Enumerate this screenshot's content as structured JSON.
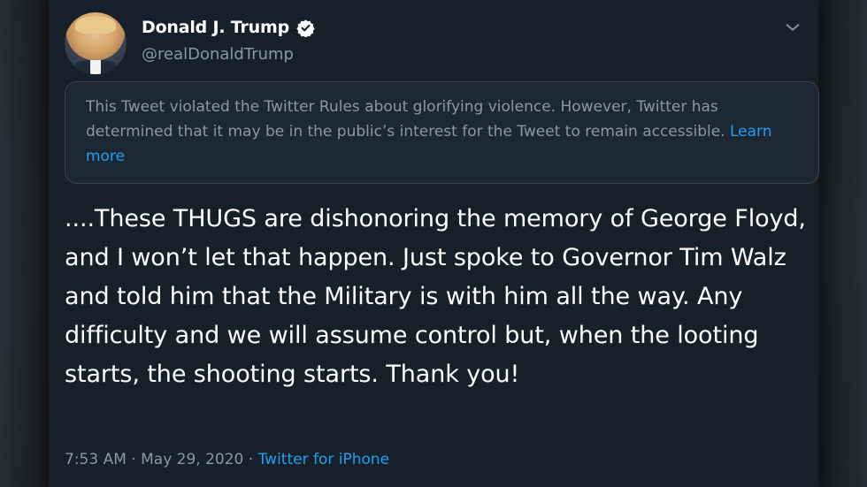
{
  "author": {
    "display_name": "Donald J. Trump",
    "handle": "@realDonaldTrump",
    "verified_icon": "verified-badge-icon"
  },
  "notice": {
    "text": "This Tweet violated the Twitter Rules about glorifying violence. However, Twitter has determined that it may be in the public’s interest for the Tweet to remain accessible. ",
    "link": "Learn more"
  },
  "tweet": {
    "text": "....These THUGS are dishonoring the memory of George Floyd, and I won’t let that happen. Just spoke to Governor Tim Walz and told him that the Military is with him all the way. Any difficulty and we will assume control but, when the looting starts, the shooting starts. Thank you!"
  },
  "meta": {
    "time": "7:53 AM",
    "separator1": " · ",
    "date": "May 29, 2020",
    "separator2": " · ",
    "source": "Twitter for iPhone"
  },
  "colors": {
    "card_bg": "#15202b",
    "link": "#1da1f2",
    "muted": "#8899a6"
  }
}
